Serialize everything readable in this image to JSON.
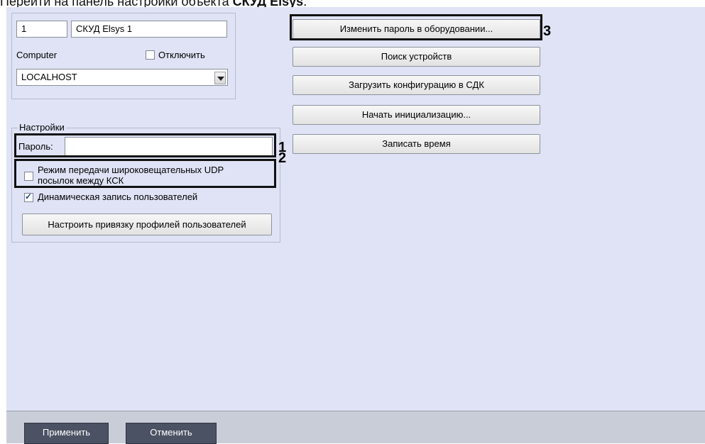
{
  "caption": {
    "prefix": "Перейти на панель настройки объекта ",
    "object": "СКУД Elsys",
    "suffix": "."
  },
  "object": {
    "id": "1",
    "name": "СКУД Elsys 1",
    "computer_label": "Computer",
    "disable_label": "Отключить",
    "computer_value": "LOCALHOST"
  },
  "settings": {
    "group_label": "Настройки",
    "password_label": "Пароль:",
    "password_value": "",
    "udp_label_line1": "Режим передачи широковещательных UDP",
    "udp_label_line2": "посылок между КСК",
    "udp_checked": false,
    "dynamic_label": "Динамическая запись пользователей",
    "dynamic_checked": true,
    "profiles_button": "Настроить привязку профилей пользователей"
  },
  "actions": {
    "change_password": "Изменить пароль в оборудовании...",
    "search_devices": "Поиск устройств",
    "upload_config": "Загрузить конфигурацию в СДК",
    "start_init": "Начать инициализацию...",
    "write_time": "Записать время"
  },
  "callouts": {
    "n1": "1",
    "n2": "2",
    "n3": "3"
  },
  "footer": {
    "apply": "Применить",
    "cancel": "Отменить"
  }
}
